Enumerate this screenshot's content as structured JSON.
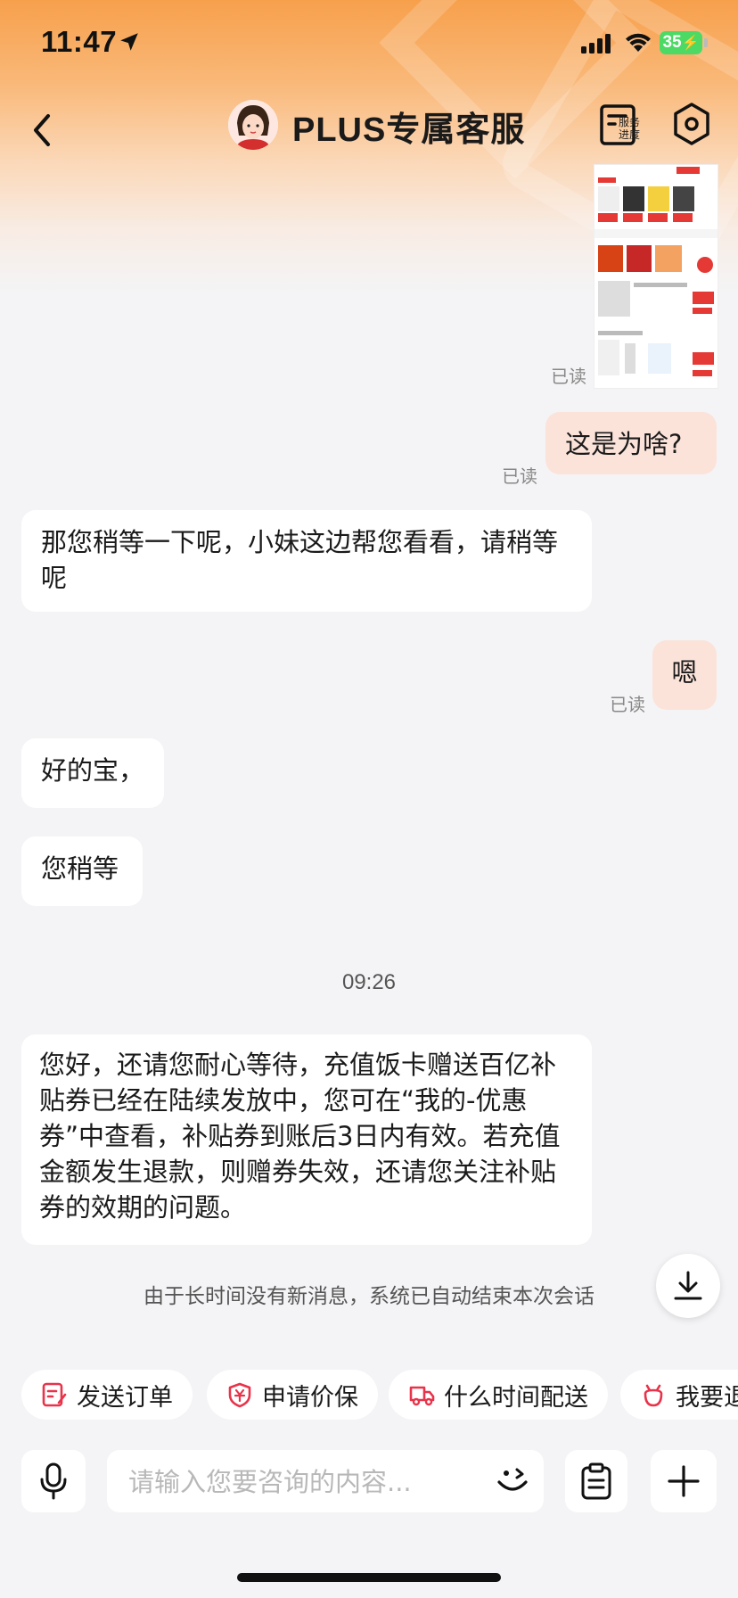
{
  "status_bar": {
    "time": "11:47",
    "battery": "35"
  },
  "nav": {
    "title": "PLUS专属客服",
    "service_label": "服务进度"
  },
  "colors": {
    "accent": "#f7a04c",
    "my_bubble": "#fbe3da",
    "icon_red": "#e8334a"
  },
  "messages": {
    "read1": "已读",
    "m1": "这是为啥?",
    "read2": "已读",
    "m2": "那您稍等一下呢，小妹这边帮您看看，请稍等呢",
    "m3": "嗯",
    "read3": "已读",
    "m4": "好的宝，",
    "m5": "您稍等",
    "time_divider": "09:26",
    "m6": "您好，还请您耐心等待，充值饭卡赠送百亿补贴券已经在陆续发放中，您可在“我的-优惠券”中查看，补贴券到账后3日内有效。若充值金额发生退款，则赠券失效，还请您关注补贴券的效期的问题。",
    "system": "由于长时间没有新消息，系统已自动结束本次会话"
  },
  "quick_actions": [
    {
      "label": "发送订单",
      "icon": "order-icon"
    },
    {
      "label": "申请价保",
      "icon": "price-protect-icon"
    },
    {
      "label": "什么时间配送",
      "icon": "delivery-truck-icon"
    },
    {
      "label": "我要退",
      "icon": "return-icon"
    }
  ],
  "input": {
    "placeholder": "请输入您要咨询的内容..."
  }
}
